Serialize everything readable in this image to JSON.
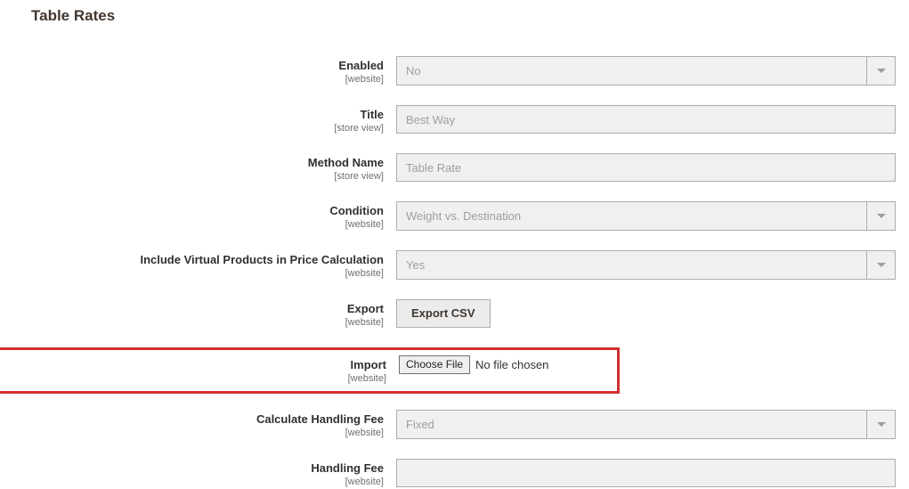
{
  "section_title": "Table Rates",
  "scopes": {
    "website": "[website]",
    "store_view": "[store view]"
  },
  "fields": {
    "enabled": {
      "label": "Enabled",
      "value": "No"
    },
    "title": {
      "label": "Title",
      "value": "Best Way"
    },
    "method_name": {
      "label": "Method Name",
      "value": "Table Rate"
    },
    "condition": {
      "label": "Condition",
      "value": "Weight vs. Destination"
    },
    "include_virtual": {
      "label": "Include Virtual Products in Price Calculation",
      "value": "Yes"
    },
    "export": {
      "label": "Export",
      "button": "Export CSV"
    },
    "import": {
      "label": "Import",
      "button": "Choose File",
      "status": "No file chosen"
    },
    "calc_handling_fee": {
      "label": "Calculate Handling Fee",
      "value": "Fixed"
    },
    "handling_fee": {
      "label": "Handling Fee",
      "value": ""
    }
  }
}
